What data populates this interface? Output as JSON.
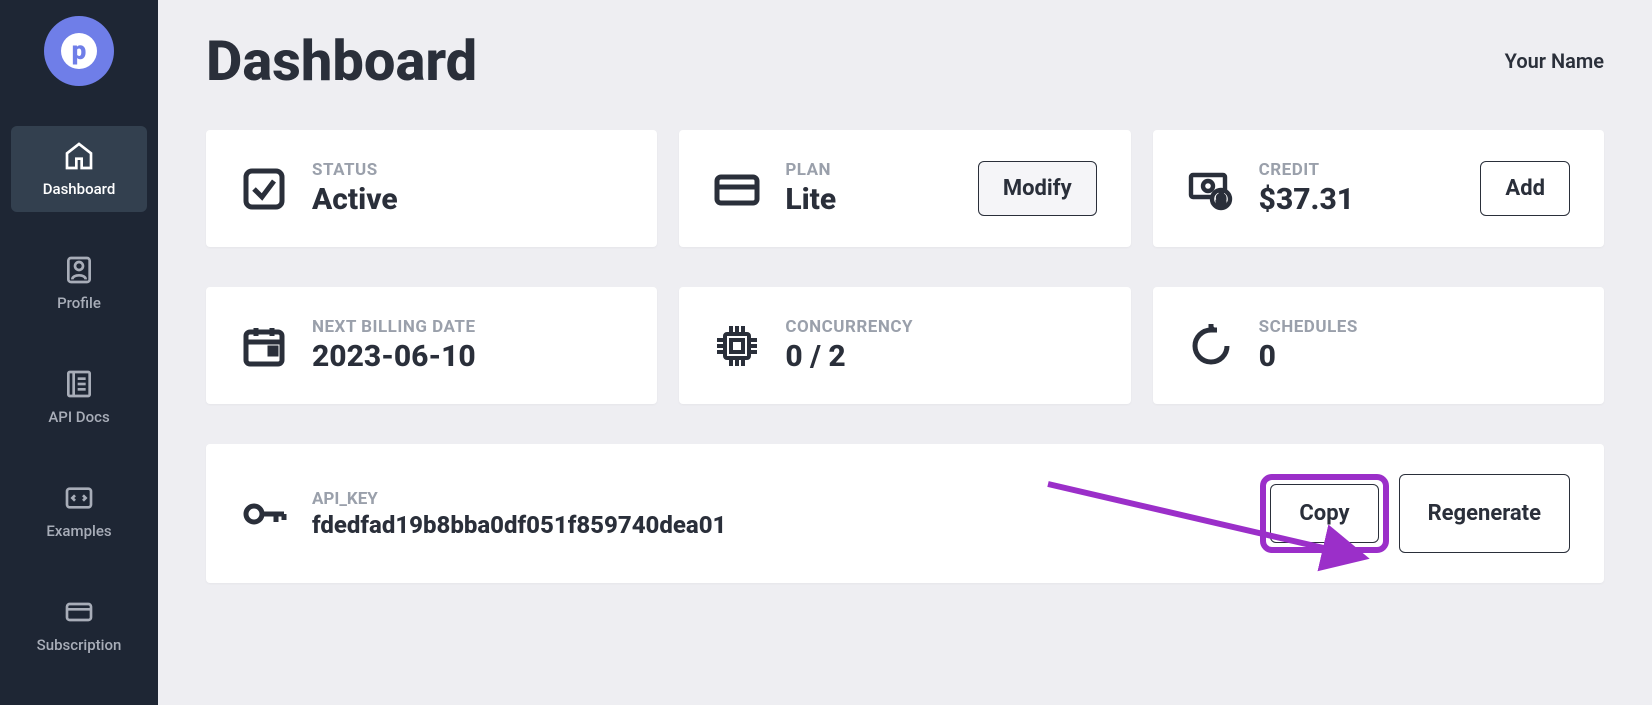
{
  "sidebar": {
    "items": [
      {
        "label": "Dashboard"
      },
      {
        "label": "Profile"
      },
      {
        "label": "API Docs"
      },
      {
        "label": "Examples"
      },
      {
        "label": "Subscription"
      }
    ]
  },
  "header": {
    "title": "Dashboard",
    "username": "Your Name"
  },
  "cards": {
    "status": {
      "label": "STATUS",
      "value": "Active"
    },
    "plan": {
      "label": "PLAN",
      "value": "Lite",
      "button": "Modify"
    },
    "credit": {
      "label": "CREDIT",
      "value": "$37.31",
      "button": "Add"
    },
    "billing": {
      "label": "NEXT BILLING DATE",
      "value": "2023-06-10"
    },
    "concurrency": {
      "label": "CONCURRENCY",
      "value": "0 / 2"
    },
    "schedules": {
      "label": "SCHEDULES",
      "value": "0"
    }
  },
  "apikey": {
    "label": "API_KEY",
    "value": "fdedfad19b8bba0df051f859740dea01",
    "copy": "Copy",
    "regen": "Regenerate"
  }
}
